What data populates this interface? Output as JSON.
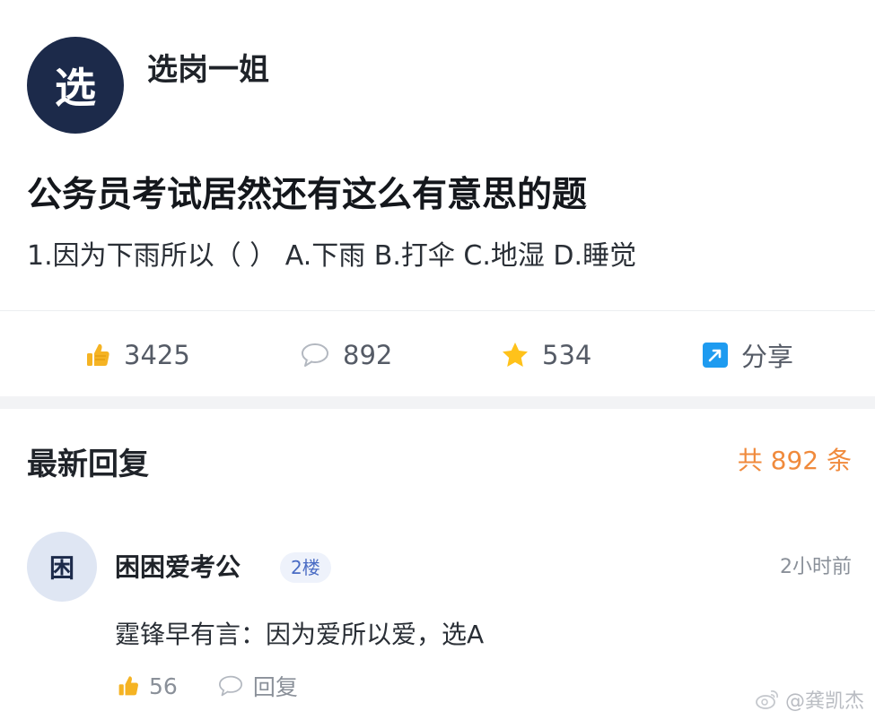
{
  "post": {
    "author_avatar_char": "选",
    "author_name": "选岗一姐",
    "title": "公务员考试居然还有这么有意思的题",
    "body": "1.因为下雨所以（ ） A.下雨 B.打伞 C.地湿 D.睡觉"
  },
  "actions": {
    "likes": "3425",
    "comments": "892",
    "favorites": "534",
    "share_label": "分享",
    "icons": {
      "like": "thumbs-up-icon",
      "comment": "comment-icon",
      "favorite": "star-icon",
      "share": "share-icon"
    }
  },
  "replies": {
    "header_title": "最新回复",
    "count_label": "共 892 条",
    "items": [
      {
        "avatar_char": "困",
        "author": "困困爱考公",
        "floor": "2楼",
        "time": "2小时前",
        "text": "霆锋早有言：因为爱所以爱，选A",
        "likes": "56",
        "reply_label": "回复"
      }
    ]
  },
  "watermark": {
    "text": "@龚凯杰",
    "icon": "weibo-icon"
  },
  "colors": {
    "avatar_dark": "#1c2a4a",
    "count_orange": "#f08a3c",
    "like_yellow": "#f5b323",
    "star_yellow": "#ffc21a",
    "share_blue": "#1e9bf0"
  }
}
